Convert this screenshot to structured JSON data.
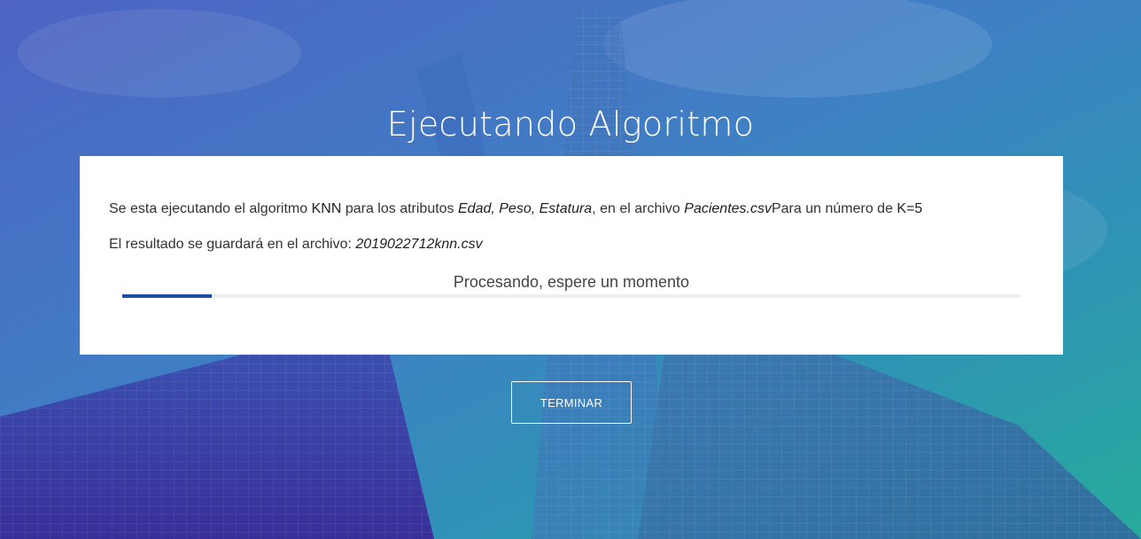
{
  "page": {
    "title": "Ejecutando Algoritmo"
  },
  "card": {
    "line1": {
      "prefix": "Se esta ejecutando el algoritmo ",
      "algorithm": "KNN",
      "mid1": " para los atributos ",
      "attributes": "Edad, Peso, Estatura",
      "mid2": ", en el archivo ",
      "file": "Pacientes.csv",
      "mid3": "Para un número de ",
      "k": "K=5"
    },
    "line2": {
      "prefix": "El resultado se guardará en el archivo: ",
      "output_file": "2019022712knn.csv"
    },
    "progress": {
      "label": "Procesando, espere un momento",
      "value": 0.1
    }
  },
  "actions": {
    "terminate_label": "TERMINAR"
  },
  "colors": {
    "progress_fill": "#1e4da8",
    "card_background": "#ffffff",
    "gradient_start": "#4a5fc0",
    "gradient_end": "#25aa9e"
  }
}
